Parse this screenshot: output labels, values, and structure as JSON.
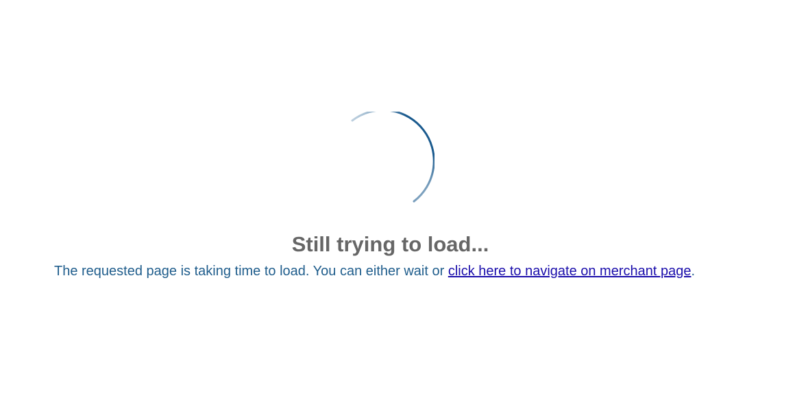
{
  "loader": {
    "spinner_icon": "loading-spinner-icon",
    "spinner_color": "#1a5a8e",
    "title": "Still trying to load...",
    "message_prefix": "The requested page is taking time to load. You can either wait or ",
    "link_text": "click here to navigate on merchant page",
    "message_suffix": "."
  },
  "colors": {
    "title": "#666666",
    "message": "#1f5d8c",
    "link": "#1a0dab",
    "background": "#ffffff"
  }
}
